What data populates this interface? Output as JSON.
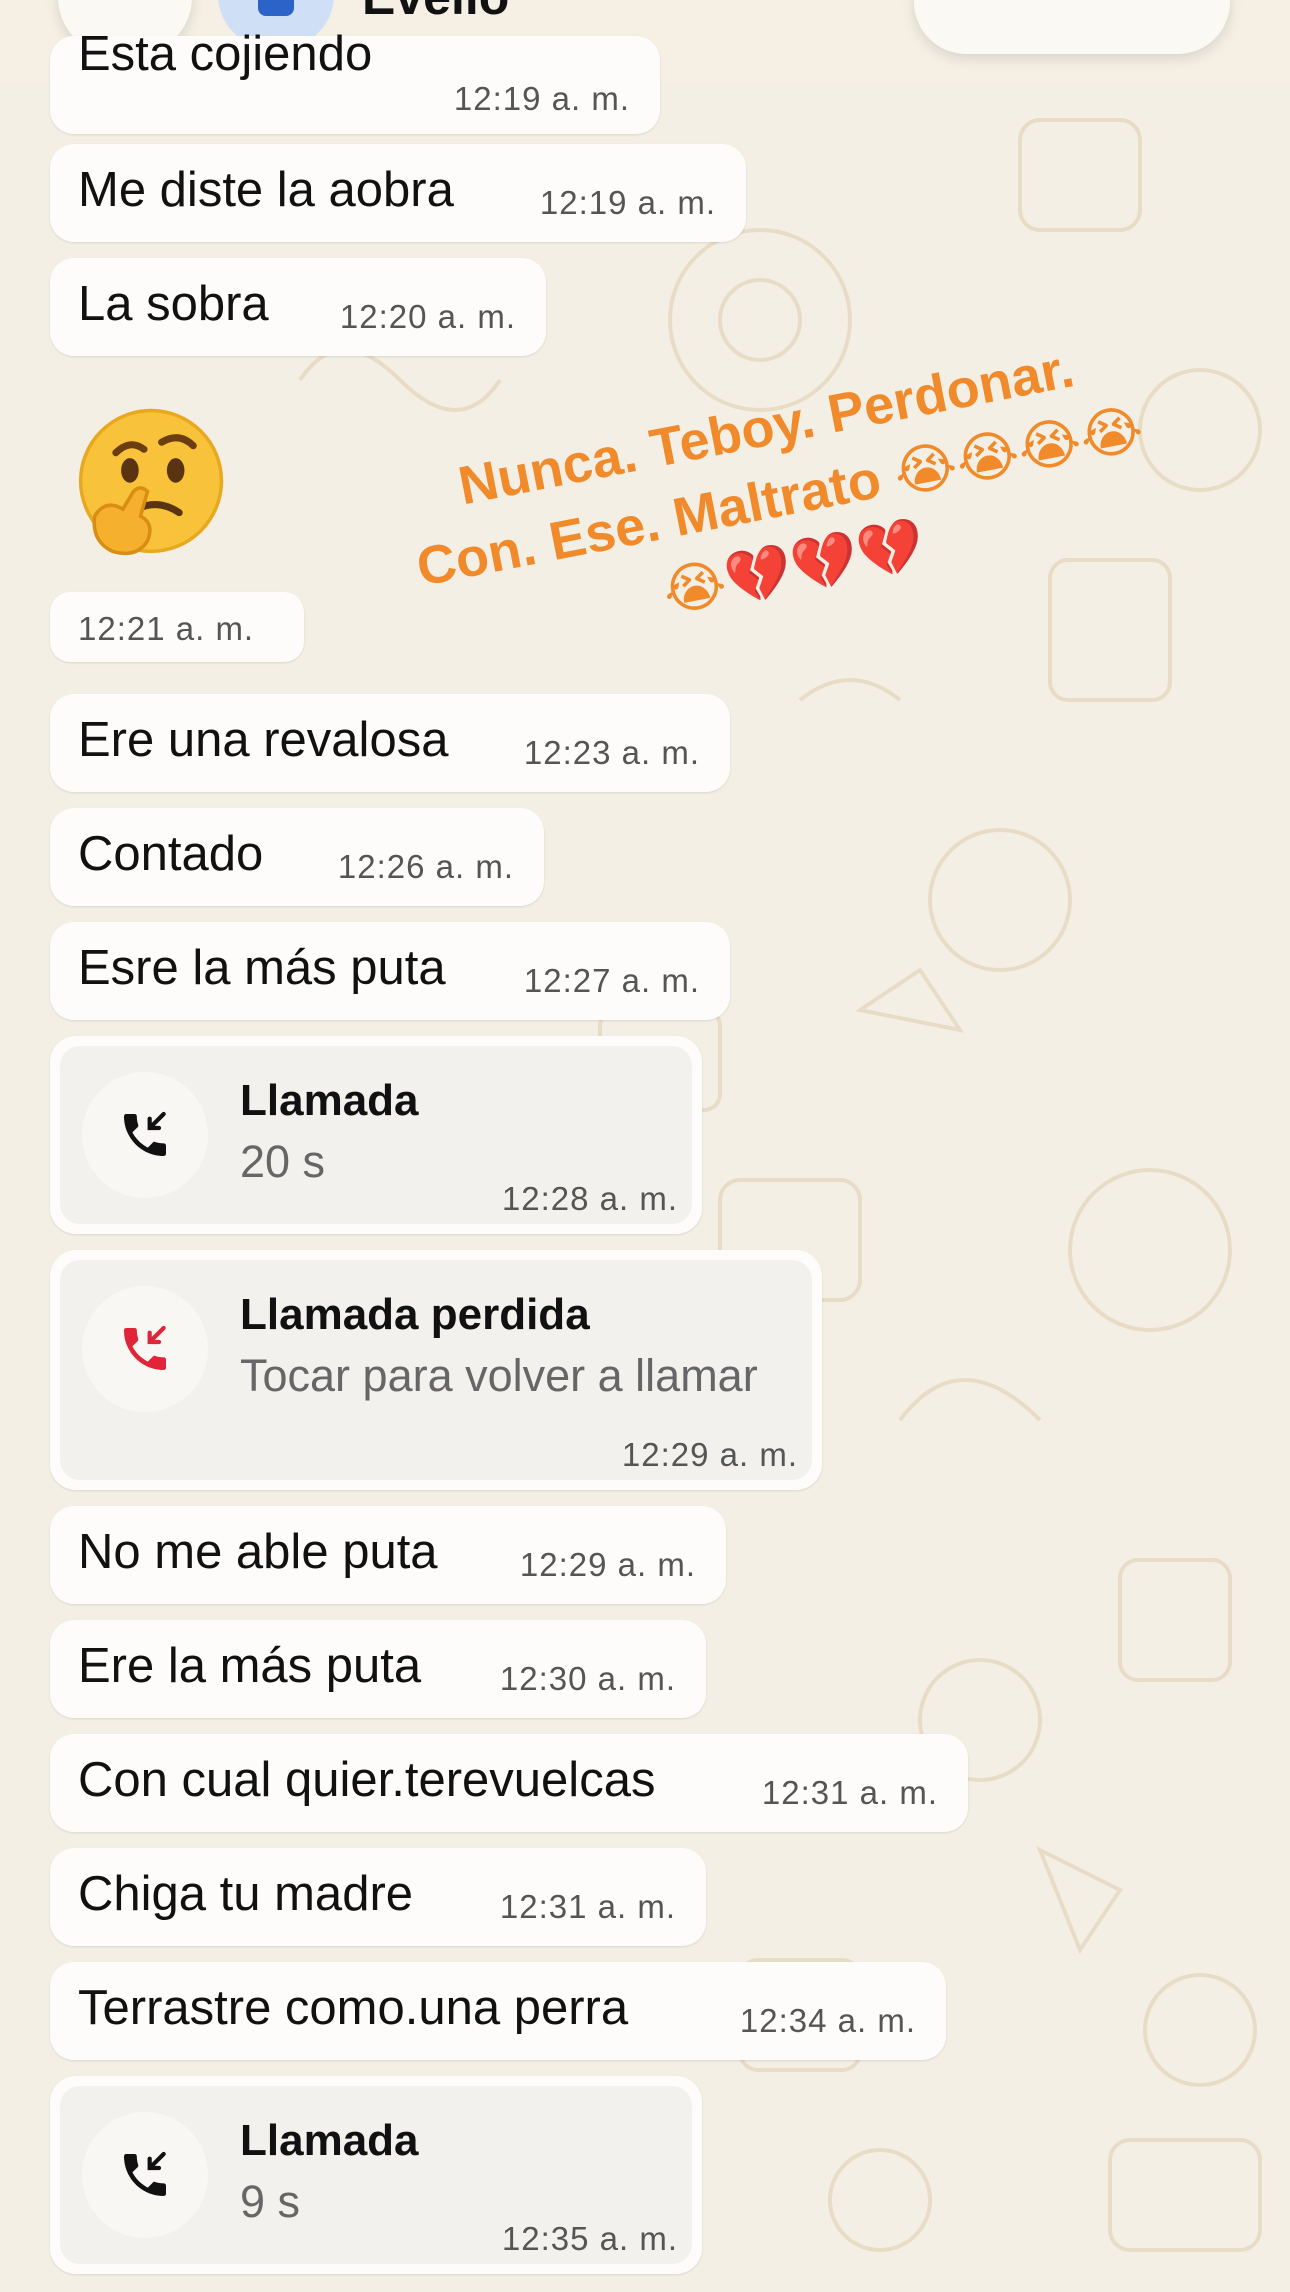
{
  "header": {
    "contact_name": "Evelio"
  },
  "messages": [
    {
      "text": "Esta cojiendo",
      "time": "12:19 a. m."
    },
    {
      "text": "Me diste la aobra",
      "time": "12:19 a. m."
    },
    {
      "text": "La sobra",
      "time": "12:20 a. m."
    },
    {
      "emoji": "thinking-face",
      "time": "12:21 a. m."
    },
    {
      "text": "Ere una revalosa",
      "time": "12:23 a. m."
    },
    {
      "text": "Contado",
      "time": "12:26 a. m."
    },
    {
      "text": "Esre la más puta",
      "time": "12:27 a. m."
    },
    {
      "type": "call",
      "title": "Llamada",
      "subtitle": "20 s",
      "time": "12:28 a. m.",
      "status": "incoming"
    },
    {
      "type": "call",
      "title": "Llamada perdida",
      "subtitle": "Tocar para volver a llamar",
      "time": "12:29 a. m.",
      "status": "missed"
    },
    {
      "text": "No me able puta",
      "time": "12:29 a. m."
    },
    {
      "text": "Ere la más puta",
      "time": "12:30 a. m."
    },
    {
      "text": "Con cual quier.terevuelcas",
      "time": "12:31 a. m."
    },
    {
      "text": "Chiga tu madre",
      "time": "12:31 a. m."
    },
    {
      "text": "Terrastre como.una perra",
      "time": "12:34 a. m."
    },
    {
      "type": "call",
      "title": "Llamada",
      "subtitle": "9 s",
      "time": "12:35 a. m.",
      "status": "incoming"
    }
  ],
  "overlay": {
    "line1": "Nunca. Teboy. Perdonar.",
    "line2": "Con. Ese. Maltrato 😭😭😭😭",
    "line3": "😭💔💔💔"
  },
  "colors": {
    "background": "#f4efe4",
    "bubble": "#fdfcfa",
    "overlay_text": "#f08a2b",
    "missed_call": "#e0243a"
  }
}
